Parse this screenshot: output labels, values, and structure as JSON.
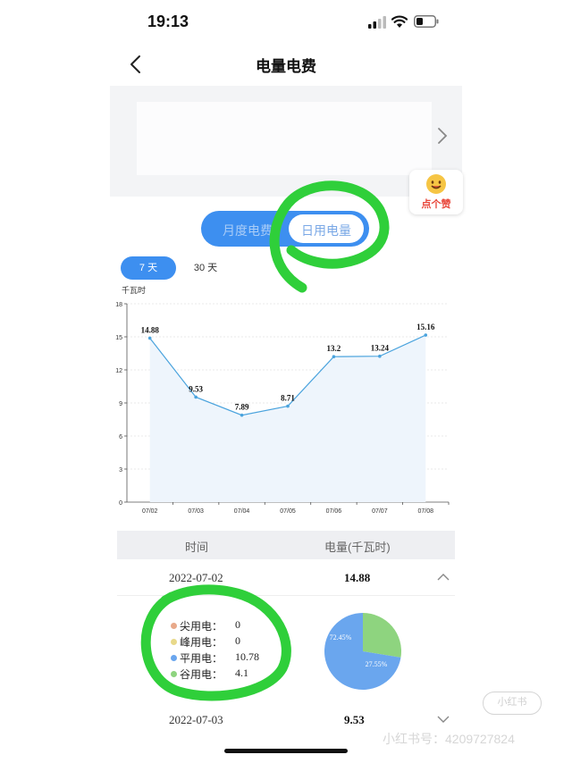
{
  "status_bar": {
    "time": "19:13"
  },
  "nav": {
    "title": "电量电费"
  },
  "like_badge": {
    "text": "点个赞"
  },
  "mode_toggle": {
    "month_label": "月度电费",
    "day_label": "日用电量",
    "selected": "日用电量"
  },
  "range_tabs": {
    "tab_7": "7 天",
    "tab_30": "30 天",
    "selected": "7 天"
  },
  "chart_data": {
    "type": "line",
    "ylabel": "千瓦时",
    "ylim": [
      0,
      18
    ],
    "yticks": [
      "0",
      "3",
      "6",
      "9",
      "12",
      "15",
      "18"
    ],
    "categories": [
      "07/02",
      "07/03",
      "07/04",
      "07/05",
      "07/06",
      "07/07",
      "07/08"
    ],
    "values": [
      14.88,
      9.53,
      7.89,
      8.71,
      13.2,
      13.24,
      15.16
    ],
    "data_labels": [
      "14.88",
      "9.53",
      "7.89",
      "8.71",
      "13.2",
      "13.24",
      "15.16"
    ],
    "grid": true,
    "area_fill": true,
    "color": "#4aa3dd"
  },
  "table": {
    "header_time": "时间",
    "header_usage": "电量(千瓦时)",
    "rows": [
      {
        "date": "2022-07-02",
        "value": "14.88",
        "expanded": true
      },
      {
        "date": "2022-07-03",
        "value": "9.53",
        "expanded": false
      }
    ]
  },
  "detail": {
    "legend": [
      {
        "label": "尖用电：",
        "value": "0",
        "color": "#e8a98a"
      },
      {
        "label": "峰用电：",
        "value": "0",
        "color": "#e8d98a"
      },
      {
        "label": "平用电：",
        "value": "10.78",
        "color": "#6aa6ee"
      },
      {
        "label": "谷用电：",
        "value": "4.1",
        "color": "#8ed47f"
      }
    ],
    "pie": {
      "slices": [
        {
          "name": "谷用电",
          "percent": 27.55,
          "label": "27.55%",
          "color": "#8ed47f"
        },
        {
          "name": "平用电",
          "percent": 72.45,
          "label": "72.45%",
          "color": "#6aa6ee"
        }
      ]
    }
  },
  "watermark": {
    "pill": "小红书",
    "text": "小红书号：4209727824"
  }
}
